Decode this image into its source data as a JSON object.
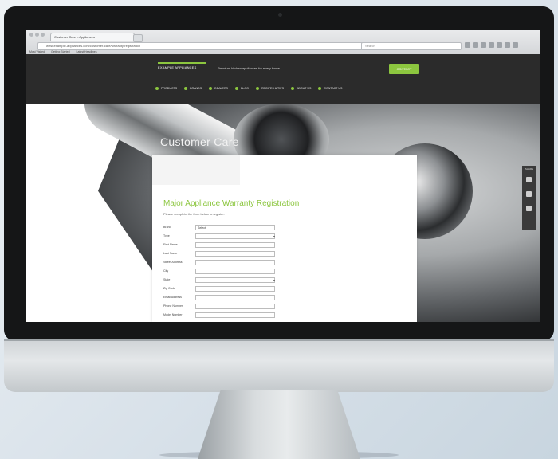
{
  "browser": {
    "tab_title": "Customer Care – Appliances",
    "url": "www.example-appliances.com/customer-care/warranty-registration",
    "search_placeholder": "Search",
    "bookmarks": [
      "Most Visited",
      "Getting Started",
      "Latest Headlines"
    ]
  },
  "site": {
    "logo_text": "EXAMPLE APPLIANCES",
    "tagline": "Premium kitchen appliances for every home",
    "cta_label": "CONTACT",
    "nav": [
      "PRODUCTS",
      "BRANDS",
      "DEALERS",
      "BLOG",
      "RECIPES & TIPS",
      "ABOUT US",
      "CONTACT US"
    ]
  },
  "hero": {
    "title": "Customer Care"
  },
  "form": {
    "title": "Major Appliance Warranty Registration",
    "subtitle": "Please complete the form below to register.",
    "fields": [
      {
        "label": "Brand",
        "value": "Select",
        "select": false
      },
      {
        "label": "Type",
        "value": "",
        "select": true
      },
      {
        "label": "First Name",
        "value": "",
        "select": false
      },
      {
        "label": "Last Name",
        "value": "",
        "select": false
      },
      {
        "label": "Street Address",
        "value": "",
        "select": false
      },
      {
        "label": "City",
        "value": "",
        "select": false
      },
      {
        "label": "State",
        "value": "",
        "select": true
      },
      {
        "label": "Zip Code",
        "value": "",
        "select": false
      },
      {
        "label": "Email Address",
        "value": "",
        "select": false
      },
      {
        "label": "Phone Number",
        "value": "",
        "select": false
      },
      {
        "label": "Model Number",
        "value": "",
        "select": false
      }
    ]
  },
  "social": {
    "label": "SHARE",
    "icons": [
      "facebook-icon",
      "twitter-icon",
      "email-icon"
    ]
  },
  "colors": {
    "accent": "#8cc63f",
    "header_bg": "#2b2b2b"
  }
}
